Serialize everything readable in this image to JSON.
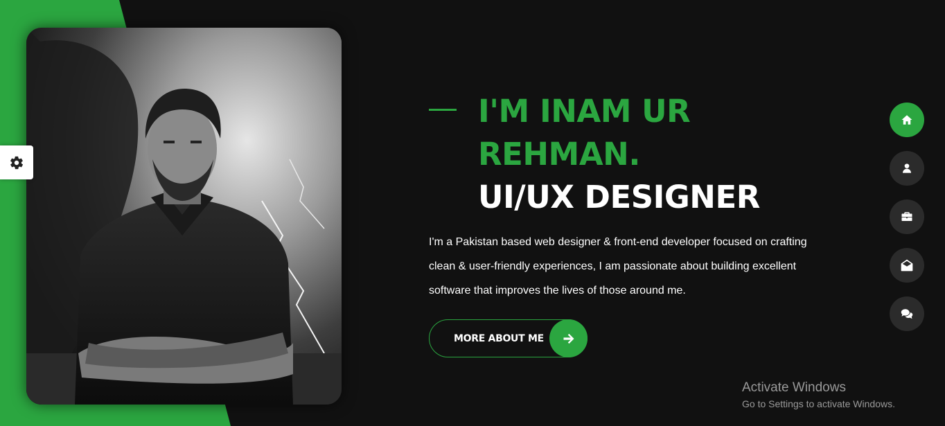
{
  "colors": {
    "accent": "#2ba640",
    "background": "#111111",
    "nav_inactive": "#2b2b2b"
  },
  "portrait": {
    "alt": "Portrait of Inam Ur Rehman"
  },
  "settings": {
    "icon": "gear-icon"
  },
  "hero": {
    "title_line1": "I'M INAM UR",
    "title_line2": "REHMAN.",
    "title_line3": "UI/UX DESIGNER",
    "description": "I'm a Pakistan based web designer & front-end developer focused on crafting clean & user-friendly experiences, I am passionate about building excellent software that improves the lives of those around me.",
    "button_label": "MORE ABOUT ME",
    "button_icon": "arrow-right-icon"
  },
  "nav": [
    {
      "name": "home",
      "icon": "home-icon",
      "active": true
    },
    {
      "name": "about",
      "icon": "user-icon",
      "active": false
    },
    {
      "name": "portfolio",
      "icon": "briefcase-icon",
      "active": false
    },
    {
      "name": "contact",
      "icon": "envelope-open-icon",
      "active": false
    },
    {
      "name": "blog",
      "icon": "comments-icon",
      "active": false
    }
  ],
  "watermark": {
    "line1": "Activate Windows",
    "line2": "Go to Settings to activate Windows."
  }
}
